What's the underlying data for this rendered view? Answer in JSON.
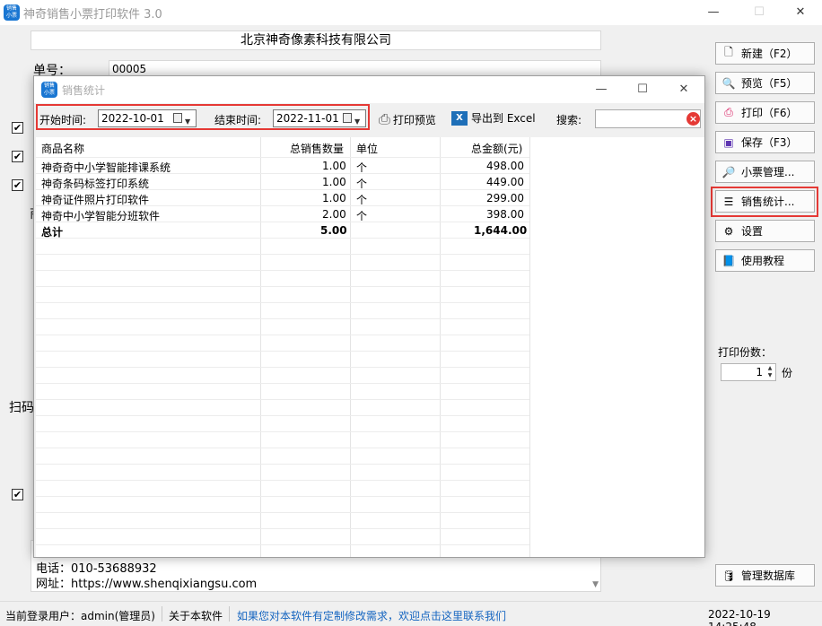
{
  "main_window": {
    "title": "神奇销售小票打印软件 3.0",
    "app_icon_text": "销售\n小票",
    "controls": {
      "minimize": "—",
      "maximize": "☐",
      "close": "✕"
    }
  },
  "form": {
    "company_name": "北京神奇像素科技有限公司",
    "order_label": "单号：",
    "order_number": "00005",
    "partial_label_1": "商",
    "partial_label_2": "扫码",
    "footer_phone": "电话：010-53688932",
    "footer_website": "网址：https://www.shenqixiangsu.com"
  },
  "right_panel": {
    "buttons": [
      {
        "label": "新建（F2）",
        "icon": "new-document-icon"
      },
      {
        "label": "预览（F5）",
        "icon": "search-icon"
      },
      {
        "label": "打印（F6）",
        "icon": "printer-icon"
      },
      {
        "label": "保存（F3）",
        "icon": "save-icon"
      },
      {
        "label": "小票管理...",
        "icon": "magnifier-icon"
      },
      {
        "label": "销售统计...",
        "icon": "list-icon"
      },
      {
        "label": "设置",
        "icon": "gear-icon"
      },
      {
        "label": "使用教程",
        "icon": "book-icon"
      }
    ],
    "copies_label": "打印份数：",
    "copies_value": "1",
    "copies_unit": "份",
    "db_button": "管理数据库"
  },
  "dialog": {
    "title": "销售统计",
    "start_label": "开始时间:",
    "start_date": "2022-10-01",
    "end_label": "结束时间:",
    "end_date": "2022-11-01",
    "print_preview": "打印预览",
    "export_excel": "导出到 Excel",
    "search_label": "搜索:",
    "search_value": "",
    "columns": [
      "商品名称",
      "总销售数量",
      "单位",
      "总金额(元)"
    ],
    "rows": [
      {
        "name": "神奇奇中小学智能排课系统",
        "qty": "1.00",
        "unit": "个",
        "amount": "498.00"
      },
      {
        "name": "神奇条码标签打印系统",
        "qty": "1.00",
        "unit": "个",
        "amount": "449.00"
      },
      {
        "name": "神奇证件照片打印软件",
        "qty": "1.00",
        "unit": "个",
        "amount": "299.00"
      },
      {
        "name": "神奇中小学智能分班软件",
        "qty": "2.00",
        "unit": "个",
        "amount": "398.00"
      }
    ],
    "total": {
      "name": "总计",
      "qty": "5.00",
      "unit": "",
      "amount": "1,644.00"
    }
  },
  "status_bar": {
    "user": "当前登录用户：admin(管理员)",
    "about": "关于本软件",
    "custom_link": "如果您对本软件有定制修改需求，欢迎点击这里联系我们",
    "datetime": "2022-10-19 14:25:48"
  },
  "colors": {
    "accent_red": "#e53935",
    "link_blue": "#1565c0",
    "icon_blue": "#1976d2"
  }
}
